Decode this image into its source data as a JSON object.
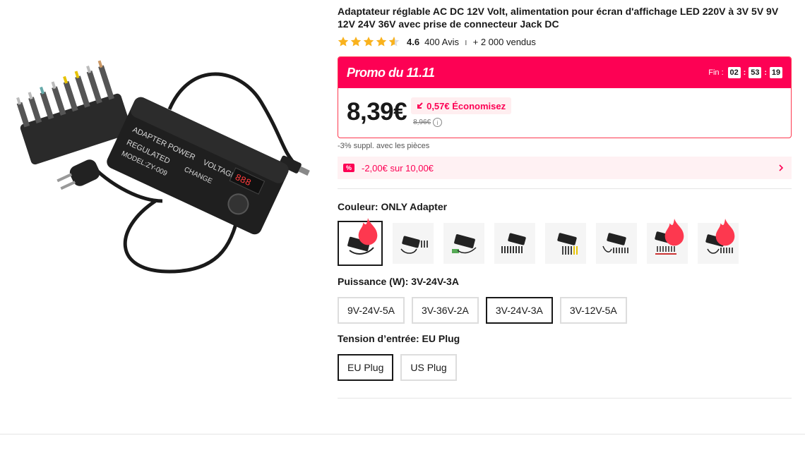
{
  "product": {
    "title": "Adaptateur réglable AC DC 12V Volt, alimentation pour écran d'affichage LED 220V à 3V 5V 9V 12V 24V 36V avec prise de connecteur Jack DC",
    "rating": "4.6",
    "reviews": "400 Avis",
    "separator": "ı",
    "sold": "+ 2 000 vendus",
    "image_text": [
      "ADAPTER POWER",
      "VOLTAGE",
      "REGULATED",
      "CHANGE",
      "MODEL:ZY-009"
    ]
  },
  "promo": {
    "title": "Promo du 11.11",
    "countdown_label": "Fin :",
    "hours": "02",
    "minutes": "53",
    "seconds": "19",
    "colon": ":",
    "price": "8,39€",
    "savings": "0,57€ Économisez",
    "old_price": "8,96€",
    "info_symbol": "i"
  },
  "extra_discount": "-3% suppl. avec les pièces",
  "coupon": {
    "icon_text": "%",
    "text": "-2,00€ sur 10,00€"
  },
  "color": {
    "label": "Couleur: ONLY Adapter",
    "variant_count": 8,
    "selected_index": 0,
    "hot_indices": [
      0,
      6,
      7
    ]
  },
  "power": {
    "label": "Puissance (W): 3V-24V-3A",
    "options": [
      "9V-24V-5A",
      "3V-36V-2A",
      "3V-24V-3A",
      "3V-12V-5A"
    ],
    "selected": "3V-24V-3A"
  },
  "tension": {
    "label": "Tension d’entrée: EU Plug",
    "options": [
      "EU Plug",
      "US Plug"
    ],
    "selected": "EU Plug"
  },
  "colors": {
    "accent": "#fd0154",
    "star": "#f9b21d",
    "text": "#191919"
  },
  "icons": {
    "star": "star-icon",
    "fire": "fire-icon",
    "coupon": "coupon-icon",
    "chevron": "chevron-right-icon",
    "info": "info-icon"
  }
}
